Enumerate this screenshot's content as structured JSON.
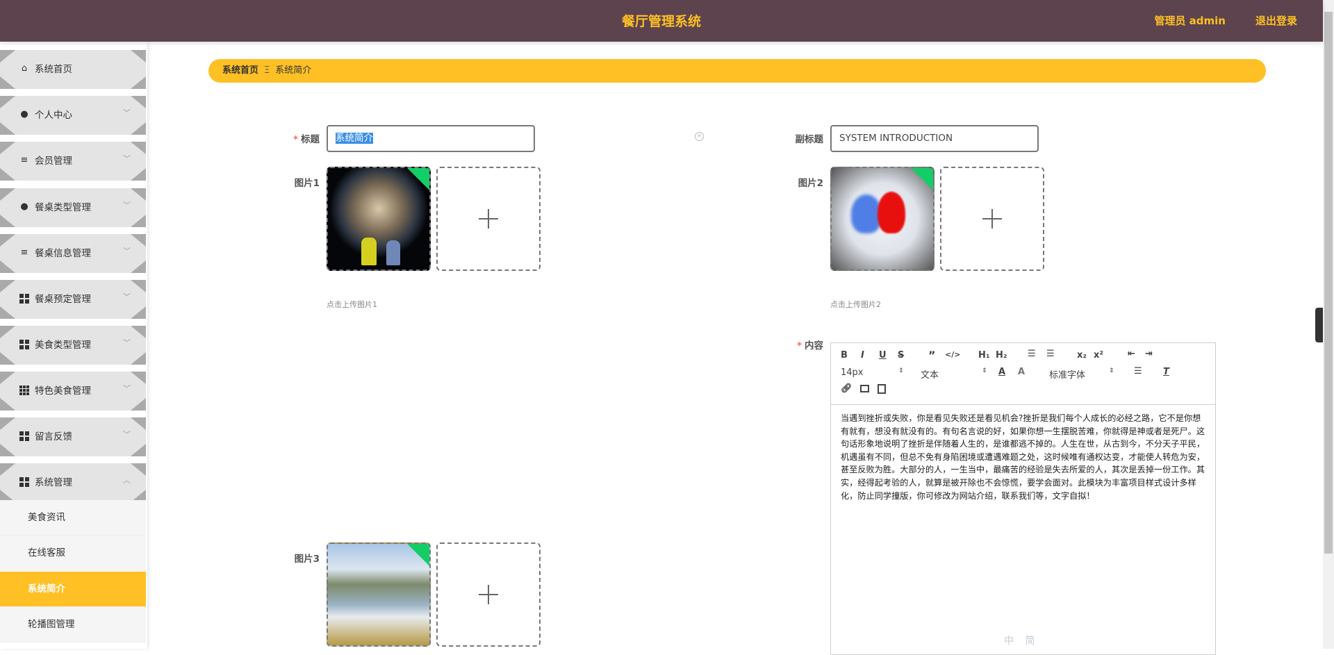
{
  "header": {
    "title": "餐厅管理系统",
    "user": "管理员 admin",
    "logout": "退出登录"
  },
  "sidebar": {
    "items": [
      {
        "label": "系统首页",
        "icon": "home-icon"
      },
      {
        "label": "个人中心",
        "icon": "user-icon"
      },
      {
        "label": "会员管理",
        "icon": "list-icon"
      },
      {
        "label": "餐桌类型管理",
        "icon": "bulb-icon"
      },
      {
        "label": "餐桌信息管理",
        "icon": "sliders-icon"
      },
      {
        "label": "餐桌预定管理",
        "icon": "grid-icon"
      },
      {
        "label": "美食类型管理",
        "icon": "grid-icon"
      },
      {
        "label": "特色美食管理",
        "icon": "grid9-icon"
      },
      {
        "label": "留言反馈",
        "icon": "grid-icon"
      },
      {
        "label": "系统管理",
        "icon": "grid-icon"
      }
    ],
    "subitems": [
      {
        "label": "美食资讯"
      },
      {
        "label": "在线客服"
      },
      {
        "label": "系统简介",
        "active": true
      },
      {
        "label": "轮播图管理"
      }
    ]
  },
  "breadcrumb": {
    "home": "系统首页",
    "current": "系统简介"
  },
  "form": {
    "title_label": "标题",
    "title_value": "系统简介",
    "subtitle_label": "副标题",
    "subtitle_value": "SYSTEM INTRODUCTION",
    "pic1_label": "图片1",
    "pic1_tip": "点击上传图片1",
    "pic2_label": "图片2",
    "pic2_tip": "点击上传图片2",
    "pic3_label": "图片3",
    "content_label": "内容"
  },
  "editor": {
    "font_size": "14px",
    "header": "文本",
    "font": "标准字体",
    "content": "当遇到挫折或失败，你是看见失败还是看见机会?挫折是我们每个人成长的必经之路，它不是你想有就有，想没有就没有的。有句名言说的好，如果你想一生摆脱苦难，你就得是神或者是死尸。这句话形象地说明了挫折是伴随着人生的，是谁都逃不掉的。人生在世，从古到今，不分天子平民，机遇虽有不同，但总不免有身陷困境或遭遇难题之处，这时候唯有通权达变，才能使人转危为安，甚至反败为胜。大部分的人，一生当中，最痛苦的经验是失去所爱的人，其次是丢掉一份工作。其实，经得起考验的人，就算是被开除也不会惊慌，要学会面对。此模块为丰富项目样式设计多样化，防止同学撞版，你可修改为网站介绍，联系我们等，文字自拟！"
  },
  "ime": {
    "text": "中 简"
  },
  "colors": {
    "header": "#5d434e",
    "accent": "#fec024",
    "success": "#13ce66"
  }
}
